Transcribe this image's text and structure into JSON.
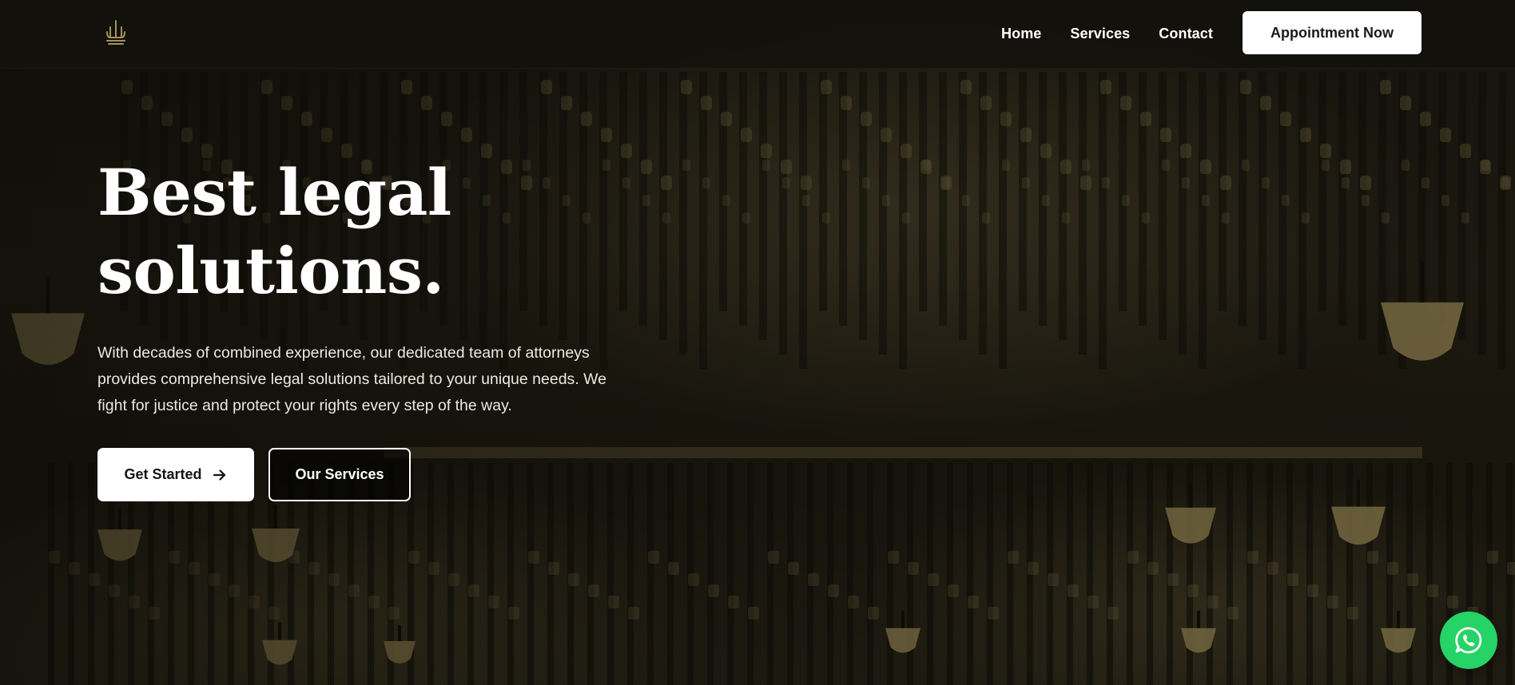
{
  "navbar": {
    "logo_icon": "scales-pillar-icon",
    "links": [
      {
        "label": "Home"
      },
      {
        "label": "Services"
      },
      {
        "label": "Contact"
      }
    ],
    "cta_label": "Appointment Now"
  },
  "hero": {
    "title_line1": "Best legal",
    "title_line2": "solutions.",
    "description": "With decades of combined experience, our dedicated team of attorneys provides comprehensive legal solutions tailored to your unique needs. We fight for justice and protect your rights every step of the way.",
    "primary_button": "Get Started",
    "primary_button_icon": "arrow-right-icon",
    "secondary_button": "Our Services"
  },
  "floating": {
    "whatsapp_icon": "whatsapp-icon"
  },
  "colors": {
    "accent_gold": "#a3925a",
    "whatsapp_green": "#25d366",
    "background_dark": "#141209"
  }
}
